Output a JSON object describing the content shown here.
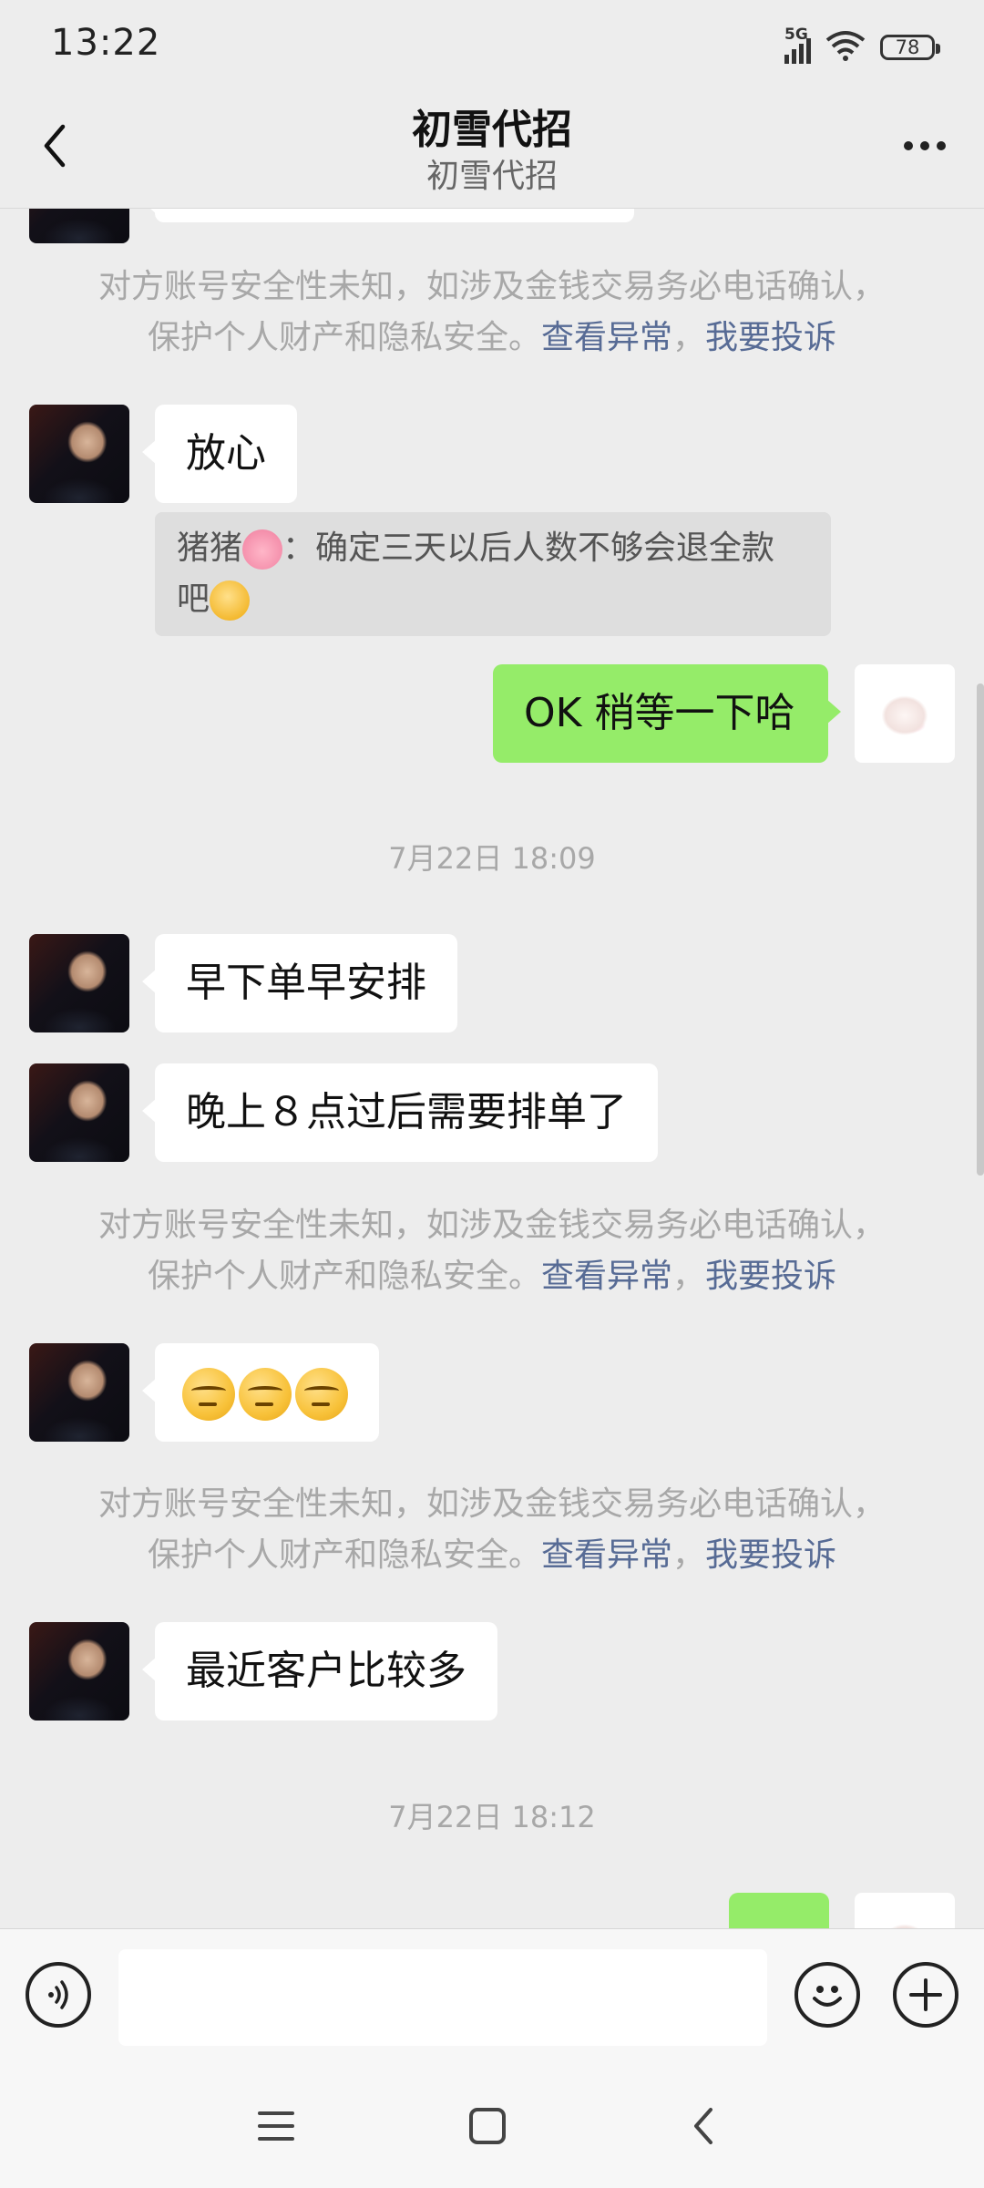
{
  "status_bar": {
    "time": "13:22",
    "network": "5G",
    "battery": "78"
  },
  "header": {
    "title": "初雪代招",
    "subtitle": "初雪代招"
  },
  "notice": {
    "line1": "对方账号安全性未知，如涉及金钱交易务必电话确认，",
    "line2_prefix": "保护个人财产和隐私安全。",
    "link_abnormal": "查看异常",
    "separator": "，",
    "link_complain": "我要投诉"
  },
  "messages": {
    "m1": "放心",
    "quote_name": "猪猪",
    "quote_colon": "：",
    "quote_text_1": "确定三天以后人数不够会退全款",
    "quote_text_2": "吧",
    "m2": "OK 稍等一下哈",
    "m3": "早下单早安排",
    "m4": "晚上８点过后需要排单了",
    "m6": "最近客户比较多"
  },
  "timestamps": {
    "t1": "7月22日 18:09",
    "t2": "7月22日 18:12"
  },
  "input": {
    "placeholder": ""
  },
  "icons": {
    "back": "chevron-left-icon",
    "more": "more-dots-icon",
    "voice": "voice-icon",
    "emoji": "emoji-icon",
    "plus": "plus-icon",
    "nav_menu": "menu-icon",
    "nav_home": "home-square-icon",
    "nav_back": "nav-back-icon"
  },
  "colors": {
    "background": "#ededed",
    "self_bubble": "#95ec69",
    "other_bubble": "#ffffff",
    "link": "#576b95",
    "notice_text": "#a8a8a8"
  }
}
